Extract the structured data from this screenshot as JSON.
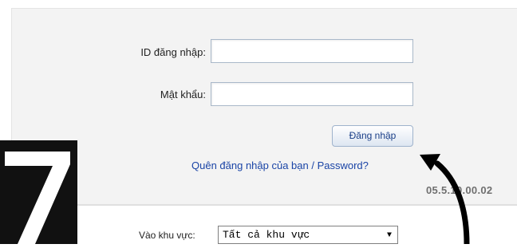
{
  "login": {
    "id_label": "ID đăng nhập:",
    "id_value": "",
    "password_label": "Mật khẩu:",
    "password_value": "",
    "submit_label": "Đăng nhập",
    "forgot_link": "Quên đăng nhập của bạn / Password?",
    "version": "05.5.10.00.02"
  },
  "region": {
    "label": "Vào khu vực:",
    "selected": "Tất cả khu vực"
  },
  "overlay": {
    "step_number": "7"
  }
}
